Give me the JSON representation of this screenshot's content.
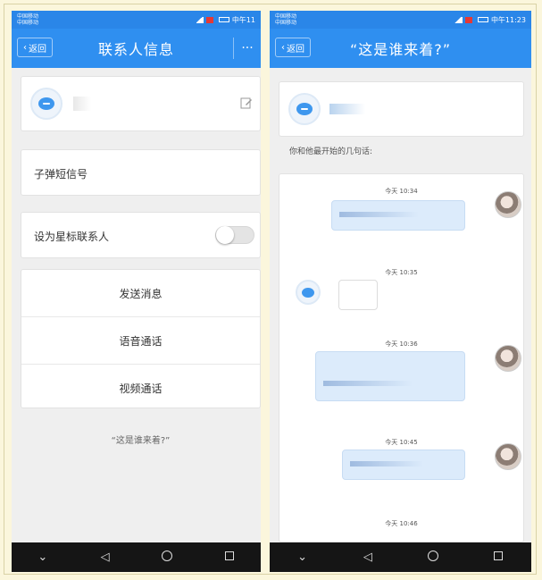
{
  "left_phone": {
    "status": {
      "carrier_line1": "中国移动",
      "carrier_line2": "中国移动",
      "time": "中午11"
    },
    "header": {
      "back_label": "返回",
      "title": "联系人信息",
      "more_label": "···"
    },
    "rows": {
      "app_name": "子弹短信号",
      "star_label": "设为星标联系人"
    },
    "actions": [
      "发送消息",
      "语音通话",
      "视频通话"
    ],
    "footer_link": "“这是谁来着?”",
    "star_toggle": {
      "on": false
    }
  },
  "right_phone": {
    "status": {
      "carrier_line1": "中国移动",
      "carrier_line2": "中国移动",
      "time": "中午11:23"
    },
    "header": {
      "back_label": "返回",
      "title": "“这是谁来着?”"
    },
    "subtitle": "你和他最开始的几句话:",
    "chat": {
      "timestamps": [
        "今天 10:34",
        "今天 10:35",
        "今天 10:36",
        "今天 10:45",
        "今天 10:46"
      ]
    }
  },
  "colors": {
    "status_bar": "#2a86e8",
    "title_bar": "#2f8ff0",
    "page_bg": "#efefef",
    "nav_bar": "#151515",
    "bubble_blue": "#dcebfb"
  },
  "icons": {
    "back": "chevron-left-icon",
    "edit": "edit-icon",
    "more": "more-icon",
    "avatar": "message-bubble-icon",
    "nav": [
      "chevron-down-icon",
      "triangle-back-icon",
      "circle-home-icon",
      "square-recent-icon"
    ]
  }
}
